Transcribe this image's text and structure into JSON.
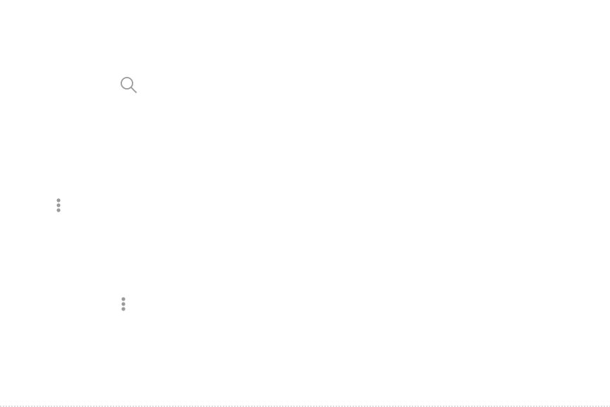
{
  "screen": {
    "background_color": "#ffffff",
    "icon_color": "#9a9a9a"
  },
  "icons": {
    "search": "search-icon",
    "more_options_primary": "more-vertical-icon",
    "more_options_secondary": "more-vertical-icon"
  }
}
